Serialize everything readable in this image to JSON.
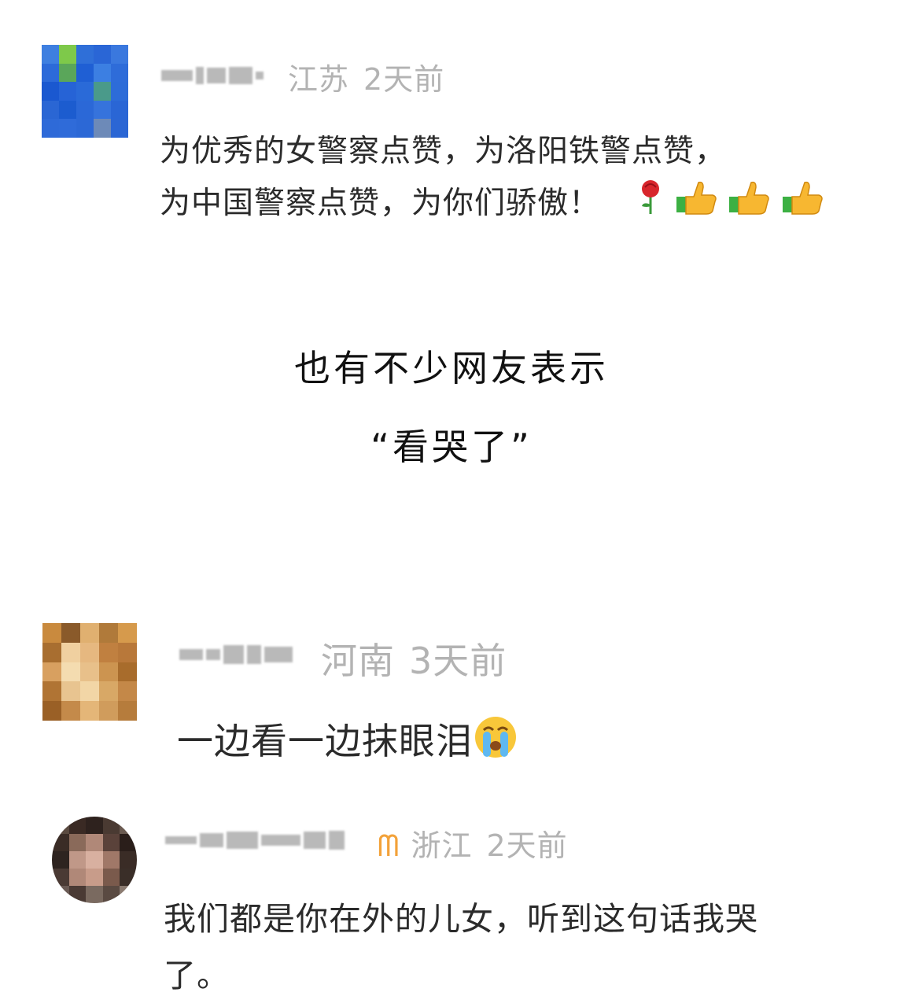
{
  "comments": [
    {
      "region": "江苏",
      "time": "2天前",
      "text_line1": "为优秀的女警察点赞，为洛阳铁警点赞，",
      "text_line2": "为中国警察点赞，为你们骄傲！",
      "emojis": [
        "rose-icon",
        "thumbs-up-icon",
        "thumbs-up-icon",
        "thumbs-up-icon"
      ]
    },
    {
      "region": "河南",
      "time": "3天前",
      "text_line1": "一边看一边抹眼泪",
      "emojis": [
        "crying-face-icon"
      ]
    },
    {
      "region": "浙江",
      "time": "2天前",
      "badge": "ᗰ",
      "text_line1": "我们都是你在外的儿女，听到这句话我哭",
      "text_line2": "了。"
    }
  ],
  "caption": {
    "line1": "也有不少网友表示",
    "line2": "“看哭了”"
  },
  "colors": {
    "meta_gray": "#b3b3b3",
    "badge_orange": "#f3a23a",
    "thumbs_yellow": "#f7b731",
    "thumbs_cuff_green": "#3cb043"
  }
}
